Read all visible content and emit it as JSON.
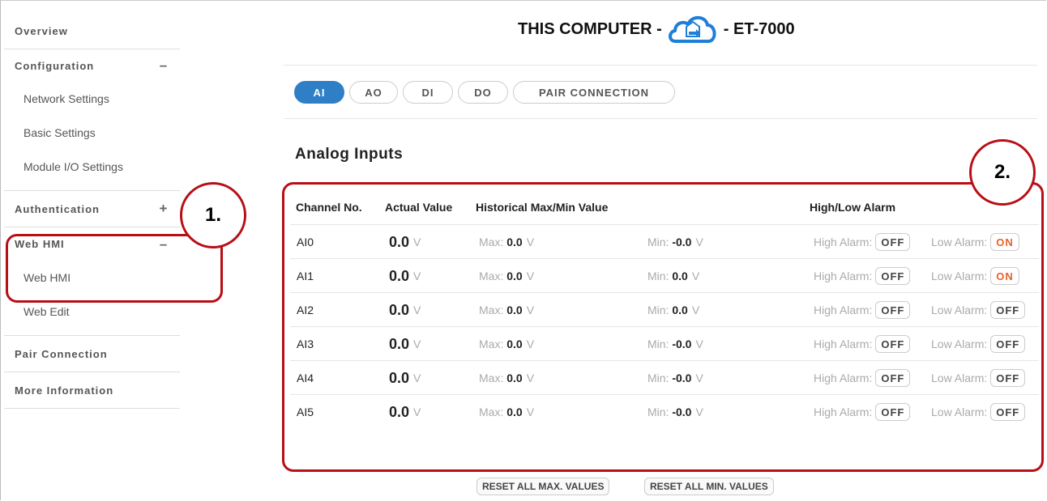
{
  "sidebar": {
    "overview": "Overview",
    "configuration": {
      "label": "Configuration",
      "toggle": "–",
      "items": [
        "Network Settings",
        "Basic Settings",
        "Module I/O Settings"
      ]
    },
    "authentication": {
      "label": "Authentication",
      "toggle": "+"
    },
    "web_hmi": {
      "label": "Web HMI",
      "toggle": "–",
      "items": [
        "Web HMI",
        "Web Edit"
      ]
    },
    "pair_connection": "Pair Connection",
    "more_information": "More Information"
  },
  "header": {
    "title_left": "THIS COMPUTER -",
    "title_right": "- ET-7000",
    "icon": "cloud-transfer-icon"
  },
  "tabs": [
    "AI",
    "AO",
    "DI",
    "DO",
    "PAIR CONNECTION"
  ],
  "active_tab": "AI",
  "section_title": "Analog Inputs",
  "table": {
    "headers": {
      "channel": "Channel No.",
      "actual": "Actual Value",
      "historical": "Historical Max/Min Value",
      "alarm": "High/Low Alarm"
    },
    "unit": "V",
    "max_prefix": "Max:",
    "min_prefix": "Min:",
    "high_prefix": "High Alarm:",
    "low_prefix": "Low Alarm:",
    "rows": [
      {
        "channel": "AI0",
        "actual": "0.0",
        "max": "0.0",
        "min": "-0.0",
        "high": "OFF",
        "low": "ON"
      },
      {
        "channel": "AI1",
        "actual": "0.0",
        "max": "0.0",
        "min": "0.0",
        "high": "OFF",
        "low": "ON"
      },
      {
        "channel": "AI2",
        "actual": "0.0",
        "max": "0.0",
        "min": "0.0",
        "high": "OFF",
        "low": "OFF"
      },
      {
        "channel": "AI3",
        "actual": "0.0",
        "max": "0.0",
        "min": "-0.0",
        "high": "OFF",
        "low": "OFF"
      },
      {
        "channel": "AI4",
        "actual": "0.0",
        "max": "0.0",
        "min": "-0.0",
        "high": "OFF",
        "low": "OFF"
      },
      {
        "channel": "AI5",
        "actual": "0.0",
        "max": "0.0",
        "min": "-0.0",
        "high": "OFF",
        "low": "OFF"
      }
    ]
  },
  "buttons": {
    "reset_max": "RESET ALL MAX. VALUES",
    "reset_min": "RESET ALL MIN. VALUES"
  },
  "annotations": {
    "callout_1": "1.",
    "callout_2": "2."
  },
  "colors": {
    "accent": "#2f7fc6",
    "annotation": "#b80f16",
    "alarm_on": "#e8622a"
  }
}
